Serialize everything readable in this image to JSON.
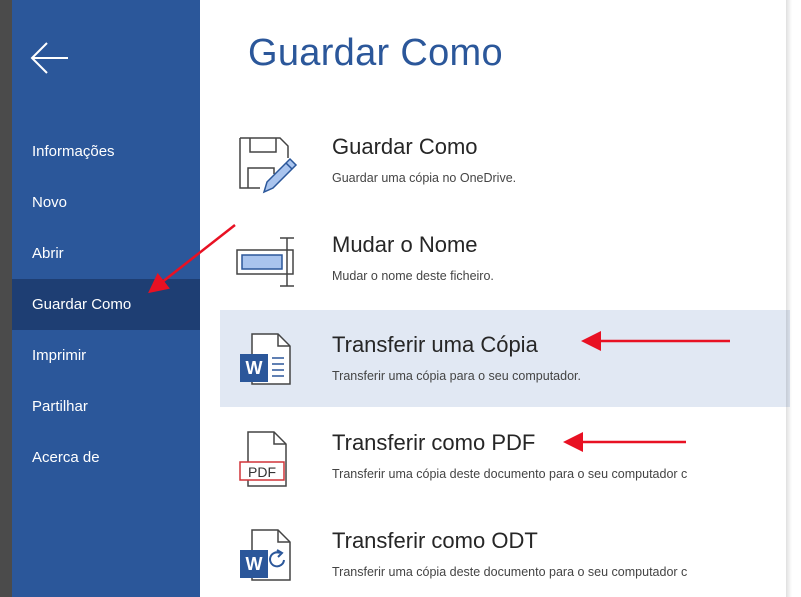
{
  "sidebar": {
    "items": [
      {
        "label": "Informações"
      },
      {
        "label": "Novo"
      },
      {
        "label": "Abrir"
      },
      {
        "label": "Guardar Como",
        "active": true
      },
      {
        "label": "Imprimir"
      },
      {
        "label": "Partilhar"
      },
      {
        "label": "Acerca de"
      }
    ],
    "back_icon": "arrow-left-icon"
  },
  "main": {
    "title": "Guardar Como",
    "options": [
      {
        "title": "Guardar Como",
        "description": "Guardar uma cópia no OneDrive.",
        "icon": "save-as-icon"
      },
      {
        "title": "Mudar o Nome",
        "description": "Mudar o nome deste ficheiro.",
        "icon": "rename-icon"
      },
      {
        "title": "Transferir uma Cópia",
        "description": "Transferir uma cópia para o seu computador.",
        "icon": "word-document-icon",
        "highlighted": true
      },
      {
        "title": "Transferir como PDF",
        "description": "Transferir uma cópia deste documento para o seu computador c",
        "icon": "pdf-document-icon",
        "icon_label": "PDF"
      },
      {
        "title": "Transferir como ODT",
        "description": "Transferir uma cópia deste documento para o seu computador c",
        "icon": "odt-document-icon"
      }
    ]
  },
  "annotations": {
    "arrow_color": "#e81123",
    "arrow_count": 3
  },
  "colors": {
    "sidebar": "#2b579a",
    "sidebar_active": "#1e3e73",
    "title": "#2b579a",
    "highlight": "#e1e8f3",
    "word_blue": "#2b579a"
  }
}
